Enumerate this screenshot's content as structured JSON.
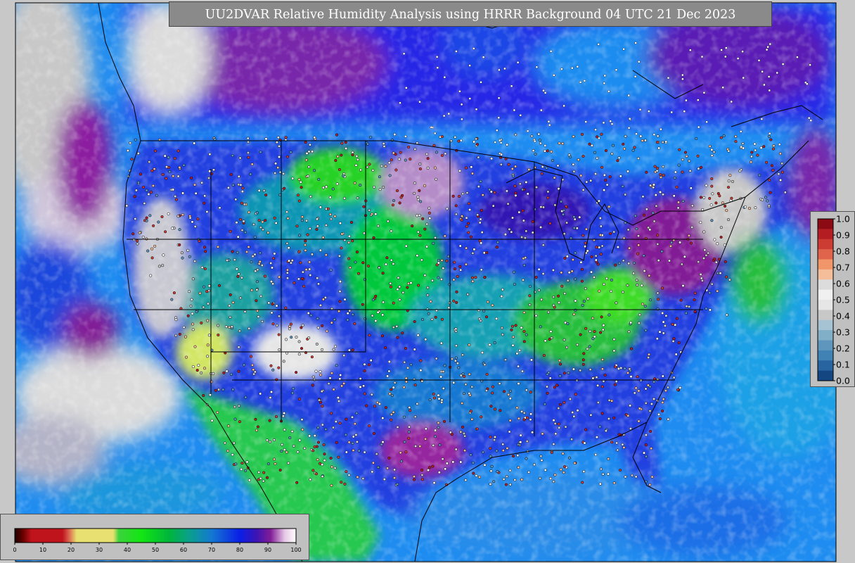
{
  "title": "UU2DVAR Relative Humidity Analysis using HRRR Background 04 UTC 21 Dec 2023",
  "rh_colorbar": {
    "ticks": [
      "0",
      "10",
      "20",
      "30",
      "40",
      "50",
      "60",
      "70",
      "80",
      "90",
      "100"
    ],
    "stops": [
      {
        "v": 0,
        "c": "#1a0000"
      },
      {
        "v": 3,
        "c": "#6b0000"
      },
      {
        "v": 6,
        "c": "#c0141c"
      },
      {
        "v": 17,
        "c": "#c0141c"
      },
      {
        "v": 19,
        "c": "#d85a4a"
      },
      {
        "v": 22,
        "c": "#e8e070"
      },
      {
        "v": 35,
        "c": "#e8e070"
      },
      {
        "v": 37,
        "c": "#3cd23c"
      },
      {
        "v": 45,
        "c": "#12e612"
      },
      {
        "v": 55,
        "c": "#00b43c"
      },
      {
        "v": 62,
        "c": "#0aa08c"
      },
      {
        "v": 70,
        "c": "#1478d2"
      },
      {
        "v": 80,
        "c": "#0a1ee6"
      },
      {
        "v": 86,
        "c": "#3c14b4"
      },
      {
        "v": 91,
        "c": "#821e96"
      },
      {
        "v": 96,
        "c": "#e6c8e6"
      },
      {
        "v": 100,
        "c": "#ffffff"
      }
    ]
  },
  "obs_colorbar": {
    "ticks": [
      "1.0",
      "0.9",
      "0.8",
      "0.7",
      "0.6",
      "0.5",
      "0.4",
      "0.3",
      "0.2",
      "0.1",
      "0.0"
    ],
    "colors": [
      "#8b0a14",
      "#b41e23",
      "#cd3c32",
      "#e0644b",
      "#f09669",
      "#f5be9b",
      "#dcdcdc",
      "#f0f0f0",
      "#e6e6e6",
      "#c8c8c8",
      "#a5c3d2",
      "#82afc8",
      "#5f96be",
      "#4182b4",
      "#2864a0",
      "#144682"
    ]
  },
  "colors": {
    "background_gray": "#c8c8c8",
    "panel_gray": "#8a8a8a",
    "ocean_blue": "#1e8cf0",
    "land_blue": "#2040e0"
  }
}
